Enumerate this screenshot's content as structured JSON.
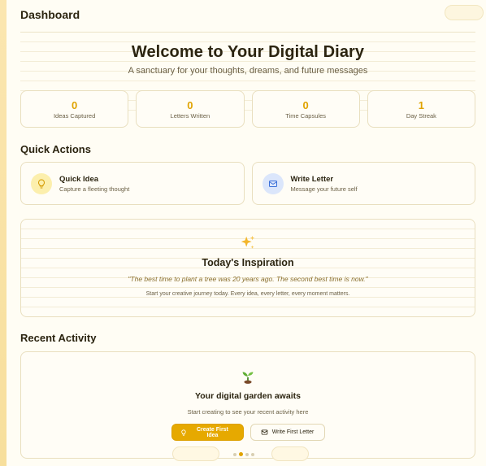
{
  "header": {
    "title": "Dashboard"
  },
  "hero": {
    "title": "Welcome to Your Digital Diary",
    "subtitle": "A sanctuary for your thoughts, dreams, and future messages"
  },
  "stats": [
    {
      "value": "0",
      "label": "Ideas Captured"
    },
    {
      "value": "0",
      "label": "Letters Written"
    },
    {
      "value": "0",
      "label": "Time Capsules"
    },
    {
      "value": "1",
      "label": "Day Streak"
    }
  ],
  "quick_actions": {
    "title": "Quick Actions",
    "items": [
      {
        "title": "Quick Idea",
        "subtitle": "Capture a fleeting thought",
        "icon": "lightbulb-icon"
      },
      {
        "title": "Write Letter",
        "subtitle": "Message your future self",
        "icon": "envelope-icon"
      }
    ]
  },
  "inspiration": {
    "icon": "sparkles-icon",
    "title": "Today's Inspiration",
    "quote": "\"The best time to plant a tree was 20 years ago. The second best time is now.\"",
    "text": "Start your creative journey today. Every idea, every letter, every moment matters."
  },
  "recent_activity": {
    "title": "Recent Activity",
    "icon": "sprout-icon",
    "empty_title": "Your digital garden awaits",
    "empty_text": "Start creating to see your recent activity here",
    "primary_button": "Create First Idea",
    "secondary_button": "Write First Letter"
  },
  "colors": {
    "accent": "#e6a900",
    "background": "#fffdf4",
    "border": "#e9dfbf"
  }
}
